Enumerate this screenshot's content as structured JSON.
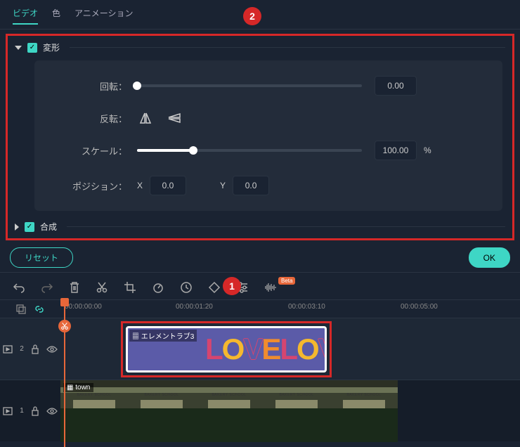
{
  "tabs": {
    "video": "ビデオ",
    "color": "色",
    "animation": "アニメーション"
  },
  "sections": {
    "transform": {
      "title": "変形",
      "rotation": {
        "label": "回転：",
        "value": "0.00"
      },
      "flip": {
        "label": "反転："
      },
      "scale": {
        "label": "スケール：",
        "value": "100.00",
        "unit": "%"
      },
      "position": {
        "label": "ポジション：",
        "x_label": "X",
        "x_value": "0.0",
        "y_label": "Y",
        "y_value": "0.0"
      }
    },
    "compositing": {
      "title": "合成"
    }
  },
  "actions": {
    "reset": "リセット",
    "ok": "OK"
  },
  "beta": "Beta",
  "timeline": {
    "ticks": [
      "00:00:00:00",
      "00:00:01:20",
      "00:00:03:10",
      "00:00:05:00"
    ],
    "track_labels": {
      "t2": "2",
      "t1": "1"
    },
    "element_clip": {
      "name": "エレメントラブ3",
      "text": "LOVELOV"
    },
    "video_clip": {
      "name": "town"
    }
  },
  "annotations": {
    "a1": "1",
    "a2": "2"
  }
}
